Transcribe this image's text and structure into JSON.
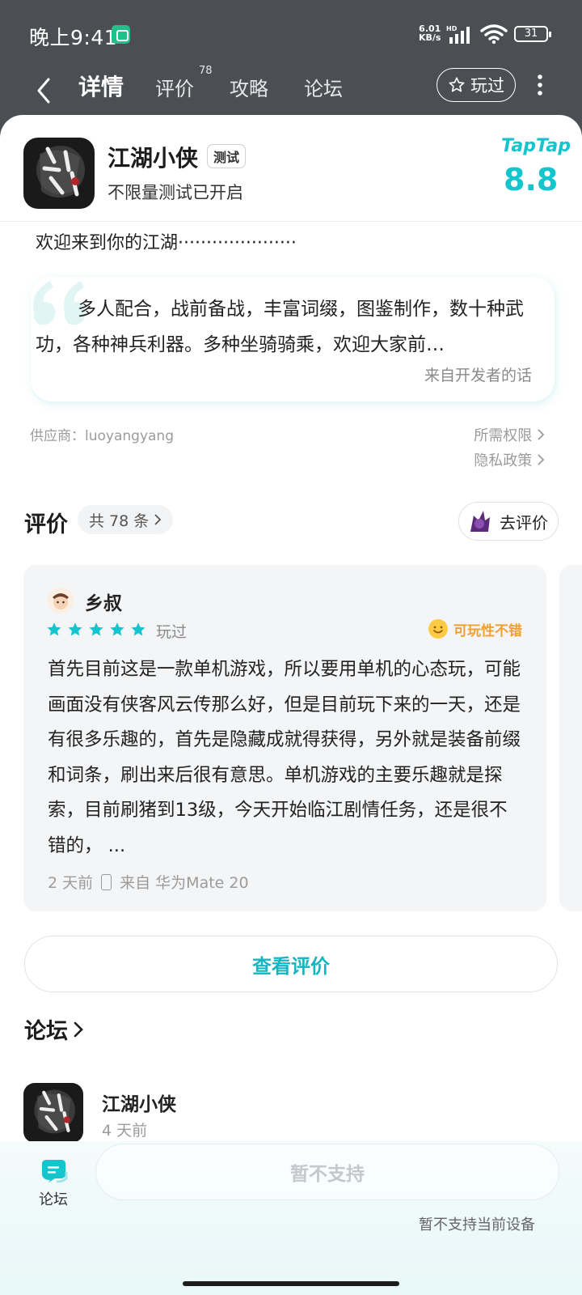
{
  "status_bar": {
    "time": "晚上9:41",
    "net_speed_value": "6.01",
    "net_speed_unit": "KB/s",
    "hd": "HD",
    "battery": "31"
  },
  "nav": {
    "tabs": [
      {
        "label": "详情",
        "active": true
      },
      {
        "label": "评价",
        "sup": "78"
      },
      {
        "label": "攻略"
      },
      {
        "label": "论坛"
      }
    ],
    "played_label": "玩过"
  },
  "app": {
    "name": "江湖小侠",
    "badge": "测试",
    "subtitle": "不限量测试已开启",
    "platform": "TapTap",
    "score": "8.8"
  },
  "intro": {
    "welcome": "欢迎来到你的江湖·····················",
    "dev_text": "多人配合，战前备战，丰富词缀，图鉴制作，数十种武功，各种神兵利器。多种坐骑骑乘，欢迎大家前…",
    "dev_from": "来自开发者的话"
  },
  "info": {
    "supplier": "供应商：luoyangyang",
    "permissions": "所需权限",
    "privacy": "隐私政策"
  },
  "reviews": {
    "title": "评价",
    "count": "共 78 条",
    "go_review": "去评价",
    "card": {
      "author": "乡叔",
      "stars": 5,
      "played": "玩过",
      "tag": "可玩性不错",
      "text": "首先目前这是一款单机游戏，所以要用单机的心态玩，可能画面没有侠客风云传那么好，但是目前玩下来的一天，还是有很多乐趣的，首先是隐藏成就得获得，另外就是装备前缀和词条，刷出来后很有意思。单机游戏的主要乐趣就是探索，目前刷猪到13级，今天开始临江剧情任务，还是很不错的， ...",
      "time": "2 天前",
      "device": "来自 华为Mate 20"
    },
    "view_all": "查看评价"
  },
  "forum": {
    "title": "论坛",
    "item_name": "江湖小侠",
    "item_time": "4 天前"
  },
  "bottom": {
    "forum_label": "论坛",
    "button_label": "暂不支持",
    "note": "暂不支持当前设备"
  },
  "colors": {
    "accent": "#15c5ce",
    "header_bg": "#4b4f53",
    "tag_orange": "#f0a030"
  }
}
